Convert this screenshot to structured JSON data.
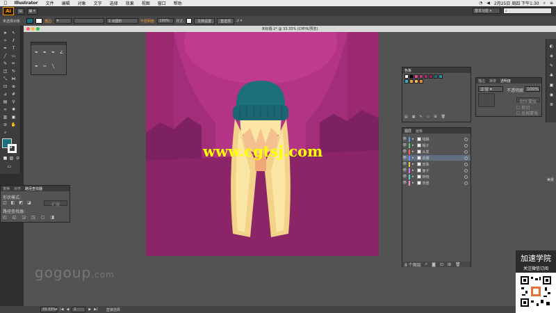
{
  "menubar": {
    "app": "Illustrator",
    "items": [
      "文件",
      "编辑",
      "对象",
      "文字",
      "选择",
      "效果",
      "视图",
      "窗口",
      "帮助"
    ],
    "clock": "2月25日 周四 下午1:30"
  },
  "appbar": {
    "logo": "Ai",
    "workspace": "基本功能",
    "search_placeholder": ""
  },
  "control": {
    "no_selection": "未选择对象",
    "stroke_label": "描边:",
    "brush_label": "3 点圆形",
    "opacity_label": "不透明度:",
    "opacity_value": "100%",
    "style_label": "样式:",
    "doc_setup": "文档设置",
    "preferences": "首选项"
  },
  "document": {
    "title": "未标题-2* @ 33.33% (CMYK/预览)"
  },
  "swatches_panel": {
    "title": "色板",
    "colors": [
      "#ffffff",
      "#000000",
      "#e74a8c",
      "#c23a7a",
      "#a32f6b",
      "#7a2a5e",
      "#1e6f7c",
      "#2a8fa0",
      "#3ab4c2",
      "#f2a53b",
      "#f4b84f",
      "#e98a2b"
    ]
  },
  "transparency_panel": {
    "tabs": [
      "描边",
      "渐变",
      "透明度"
    ],
    "mode": "正常",
    "opacity_label": "不透明度",
    "opacity_value": "100%",
    "make_mask": "制作蒙版",
    "clip": "剪切",
    "invert": "反相蒙版"
  },
  "layers_panel": {
    "tabs": [
      "图层",
      "画板"
    ],
    "layers": [
      {
        "name": "线稿",
        "color": "#5aa0ff"
      },
      {
        "name": "帽子",
        "color": "#4fd06a"
      },
      {
        "name": "头发",
        "color": "#ff5a5a"
      },
      {
        "name": "衣服",
        "color": "#6a8cff"
      },
      {
        "name": "皮肤",
        "color": "#f2c84f"
      },
      {
        "name": "面子",
        "color": "#d86bff"
      },
      {
        "name": "饰物",
        "color": "#5ad0d0"
      },
      {
        "name": "背景",
        "color": "#ff8cc8"
      }
    ],
    "count": "8 个图层"
  },
  "pathfinder_panel": {
    "tabs": [
      "变换",
      "对齐",
      "路径查找器"
    ],
    "shape_modes": "形状模式:",
    "pathfinders": "路径查找器:",
    "expand": "扩展"
  },
  "status": {
    "zoom": "33.33%",
    "page": "1",
    "tool": "直接选择"
  },
  "watermark": {
    "site": "www.cgtsj.com",
    "gogoup": "gogoup",
    "dotcom": ".com"
  },
  "promo": {
    "title": "加速学院",
    "subtitle": "关注微信订阅"
  },
  "right_rail": {
    "text": "美景"
  }
}
